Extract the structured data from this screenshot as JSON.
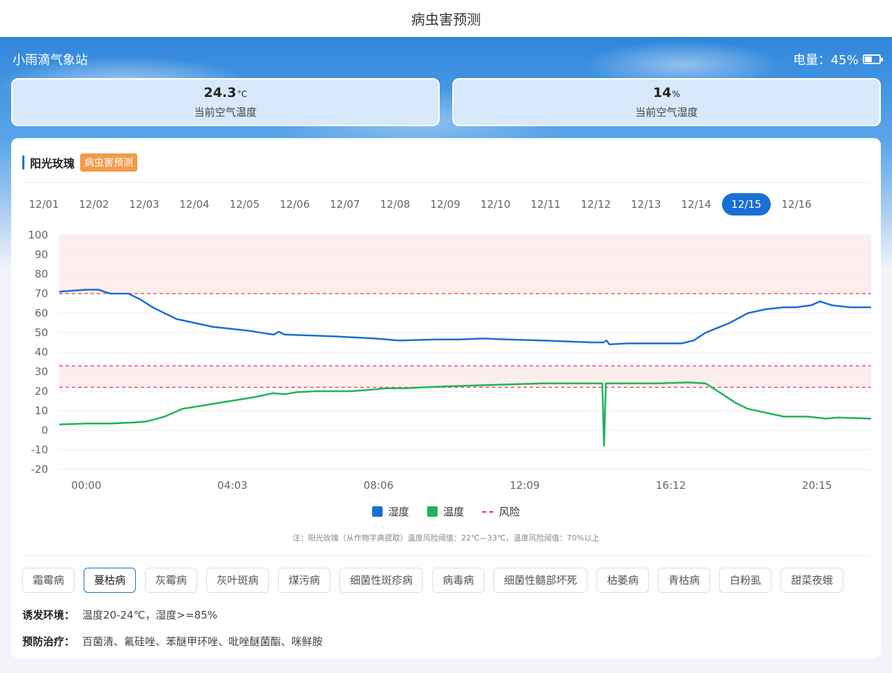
{
  "header": {
    "title": "病虫害预测"
  },
  "station": {
    "name": "小雨滴气象站",
    "battery_label": "电量：45%",
    "battery_level": 0.45
  },
  "stats": [
    {
      "value": "24.3",
      "unit": "°C",
      "label": "当前空气温度"
    },
    {
      "value": "14",
      "unit": "%",
      "label": "当前空气湿度"
    }
  ],
  "crop": {
    "name": "阳光玫瑰",
    "tag": "病虫害预测"
  },
  "dates": [
    "12/01",
    "12/02",
    "12/03",
    "12/04",
    "12/05",
    "12/06",
    "12/07",
    "12/08",
    "12/09",
    "12/10",
    "12/11",
    "12/12",
    "12/13",
    "12/14",
    "12/15",
    "12/16"
  ],
  "active_date": "12/15",
  "colors": {
    "accent": "#1a6fd6",
    "humidity": "#1a6fd6",
    "temperature": "#1fb35a",
    "risk": "#e4404f",
    "risk_band": "#fdeeee",
    "tag": "#f39a4b"
  },
  "chart_data": {
    "type": "line",
    "x_ticks": [
      "00:00",
      "04:03",
      "08:06",
      "12:09",
      "16:12",
      "20:15"
    ],
    "x_tick_minutes": [
      0,
      243,
      486,
      729,
      972,
      1215
    ],
    "xlim_minutes": [
      -45,
      1305
    ],
    "ylim": [
      -20,
      100
    ],
    "y_ticks": [
      -20,
      -10,
      0,
      10,
      20,
      30,
      40,
      50,
      60,
      70,
      80,
      90,
      100
    ],
    "grid": true,
    "legend_position": "bottom",
    "series": [
      {
        "name": "湿度",
        "points": [
          [
            -45,
            71
          ],
          [
            0,
            72
          ],
          [
            20,
            72
          ],
          [
            40,
            70
          ],
          [
            70,
            70
          ],
          [
            90,
            67
          ],
          [
            110,
            63
          ],
          [
            150,
            57
          ],
          [
            180,
            55
          ],
          [
            210,
            53
          ],
          [
            240,
            52
          ],
          [
            270,
            51
          ],
          [
            300,
            49.5
          ],
          [
            312,
            49
          ],
          [
            320,
            50.5
          ],
          [
            330,
            49
          ],
          [
            380,
            48.5
          ],
          [
            420,
            48
          ],
          [
            480,
            47
          ],
          [
            520,
            46
          ],
          [
            580,
            46.5
          ],
          [
            620,
            46.5
          ],
          [
            660,
            47
          ],
          [
            700,
            46.5
          ],
          [
            760,
            46
          ],
          [
            800,
            45.5
          ],
          [
            840,
            45
          ],
          [
            860,
            45
          ],
          [
            865,
            46
          ],
          [
            870,
            44
          ],
          [
            900,
            44.5
          ],
          [
            950,
            44.5
          ],
          [
            990,
            44.5
          ],
          [
            1010,
            46
          ],
          [
            1030,
            50
          ],
          [
            1070,
            55
          ],
          [
            1100,
            60
          ],
          [
            1130,
            62
          ],
          [
            1160,
            63
          ],
          [
            1180,
            63
          ],
          [
            1205,
            64
          ],
          [
            1220,
            66
          ],
          [
            1240,
            64
          ],
          [
            1270,
            63
          ],
          [
            1305,
            63
          ]
        ]
      },
      {
        "name": "温度",
        "points": [
          [
            -45,
            3
          ],
          [
            0,
            3.5
          ],
          [
            40,
            3.5
          ],
          [
            80,
            4
          ],
          [
            100,
            4.5
          ],
          [
            130,
            7
          ],
          [
            160,
            11
          ],
          [
            200,
            13
          ],
          [
            240,
            15
          ],
          [
            280,
            17
          ],
          [
            310,
            19
          ],
          [
            330,
            18.5
          ],
          [
            350,
            19.5
          ],
          [
            380,
            20
          ],
          [
            440,
            20
          ],
          [
            480,
            21
          ],
          [
            500,
            21.5
          ],
          [
            530,
            21.5
          ],
          [
            560,
            22
          ],
          [
            600,
            22.5
          ],
          [
            650,
            23
          ],
          [
            700,
            23.5
          ],
          [
            760,
            24
          ],
          [
            820,
            24
          ],
          [
            858,
            24
          ],
          [
            861,
            -8
          ],
          [
            864,
            24
          ],
          [
            900,
            24
          ],
          [
            950,
            24
          ],
          [
            1000,
            24.5
          ],
          [
            1030,
            24
          ],
          [
            1060,
            18
          ],
          [
            1080,
            14
          ],
          [
            1100,
            11
          ],
          [
            1130,
            9
          ],
          [
            1160,
            7
          ],
          [
            1200,
            7
          ],
          [
            1230,
            6
          ],
          [
            1250,
            6.5
          ],
          [
            1305,
            6
          ]
        ]
      }
    ],
    "risk_lines": [
      {
        "name": "风险",
        "value": 70
      },
      {
        "name": "风险",
        "value": 33
      },
      {
        "name": "风险",
        "value": 22
      }
    ],
    "risk_bands": [
      [
        70,
        100
      ],
      [
        22,
        33
      ]
    ]
  },
  "legend": [
    "湿度",
    "温度",
    "风险"
  ],
  "note": "注：阳光玫瑰（从作物字典提取）温度风险阈值：22℃—33℃，温度风险阈值：70%以上",
  "diseases": [
    "霜霉病",
    "蔓枯病",
    "灰霉病",
    "灰叶斑病",
    "煤污病",
    "细菌性斑疹病",
    "病毒病",
    "细菌性髓部坏死",
    "枯萎病",
    "青枯病",
    "白粉虱",
    "甜菜夜蛾"
  ],
  "active_disease": "蔓枯病",
  "trigger": {
    "label": "诱发环境：",
    "value": "温度20-24℃，湿度>=85%"
  },
  "prevention": {
    "label": "预防治疗：",
    "value": "百菌清、氟硅唑、苯醚甲环唑、吡唑醚菌酯、咪鲜胺"
  }
}
